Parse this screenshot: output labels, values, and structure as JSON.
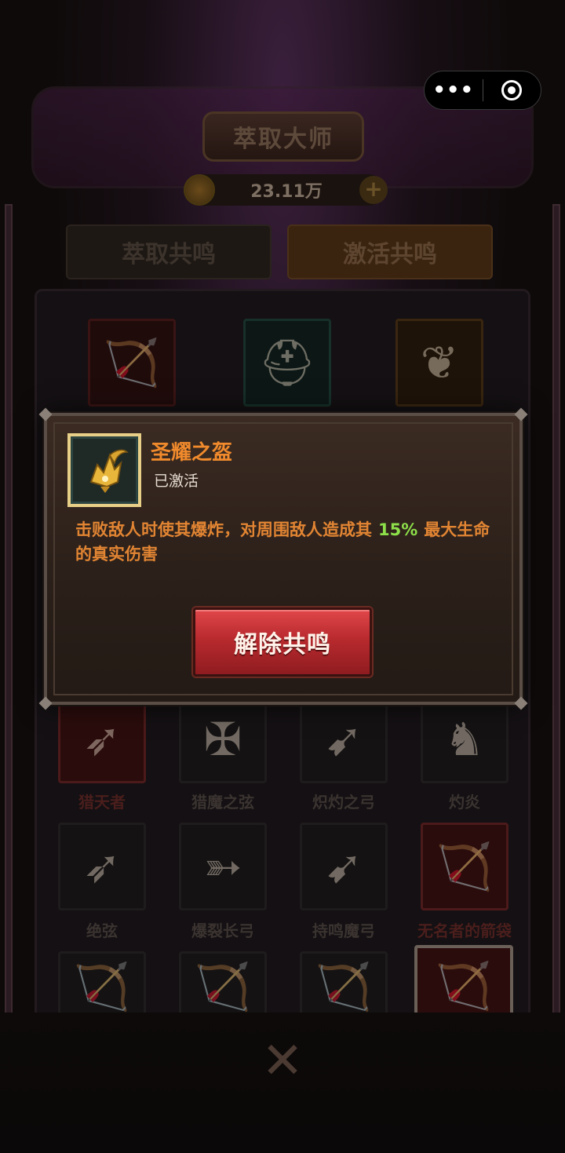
{
  "header": {
    "title": "萃取大师",
    "currency_value": "23.11万"
  },
  "tabs": [
    {
      "label": "萃取共鸣",
      "active": false
    },
    {
      "label": "激活共鸣",
      "active": true
    }
  ],
  "items": [
    {
      "name": "猎天者"
    },
    {
      "name": "猎魔之弦"
    },
    {
      "name": "炽灼之弓"
    },
    {
      "name": "灼炎"
    },
    {
      "name": "绝弦"
    },
    {
      "name": "爆裂长弓"
    },
    {
      "name": "持鸣魔弓"
    },
    {
      "name": "无名者的箭袋"
    }
  ],
  "modal": {
    "item_name": "圣耀之盔",
    "status": "已激活",
    "description_before": "击败敌人时使其爆炸，对周围敌人造成其",
    "percent": "15%",
    "description_after": "最大生命的真实伤害",
    "button_label": "解除共鸣"
  },
  "capsule": {
    "more_symbol": "•••"
  },
  "colors": {
    "title_orange": "#f08a2c",
    "percent_green": "#8de04a",
    "button_red": "#b82a2e",
    "icon_border_gold": "#e8cf88"
  }
}
